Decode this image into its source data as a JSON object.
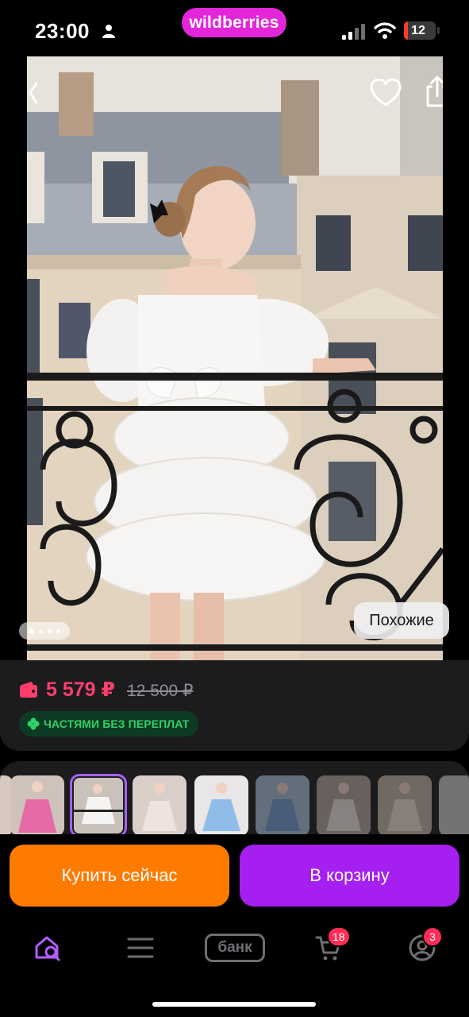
{
  "status_bar": {
    "time": "23:00",
    "brand": "wildberries",
    "battery": "12",
    "battery_level_percent": 12
  },
  "product": {
    "price": "5 579 ₽",
    "old_price": "12 500 ₽",
    "installment_label": "ЧАСТЯМИ БЕЗ ПЕРЕПЛАТ",
    "similar_label": "Похожие"
  },
  "thumbnails": [
    {
      "name": "pink-dress",
      "tone": "#e66aa6"
    },
    {
      "name": "white-dress-balcony",
      "tone": "#c9c2bb"
    },
    {
      "name": "white-dress-studio",
      "tone": "#d9cfc8"
    },
    {
      "name": "blue-dress",
      "tone": "#8fbde8"
    },
    {
      "name": "blue-dress-2",
      "tone": "#7a9cc8"
    },
    {
      "name": "white-dress-room",
      "tone": "#bfb0a8"
    },
    {
      "name": "cream-dress",
      "tone": "#cdbfb3"
    },
    {
      "name": "white-dress-partial",
      "tone": "#bbb"
    }
  ],
  "actions": {
    "buy_now": "Купить сейчас",
    "add_to_cart": "В корзину"
  },
  "tab_bar": {
    "bank_label": "банк",
    "cart_badge": "18",
    "profile_badge": "3"
  },
  "colors": {
    "brand": "#e426d9",
    "price": "#ff3e6c",
    "buy_now": "#ff7a00",
    "to_cart": "#a51ff0",
    "installment": "#2ed36b",
    "active_tab": "#b45cff"
  }
}
